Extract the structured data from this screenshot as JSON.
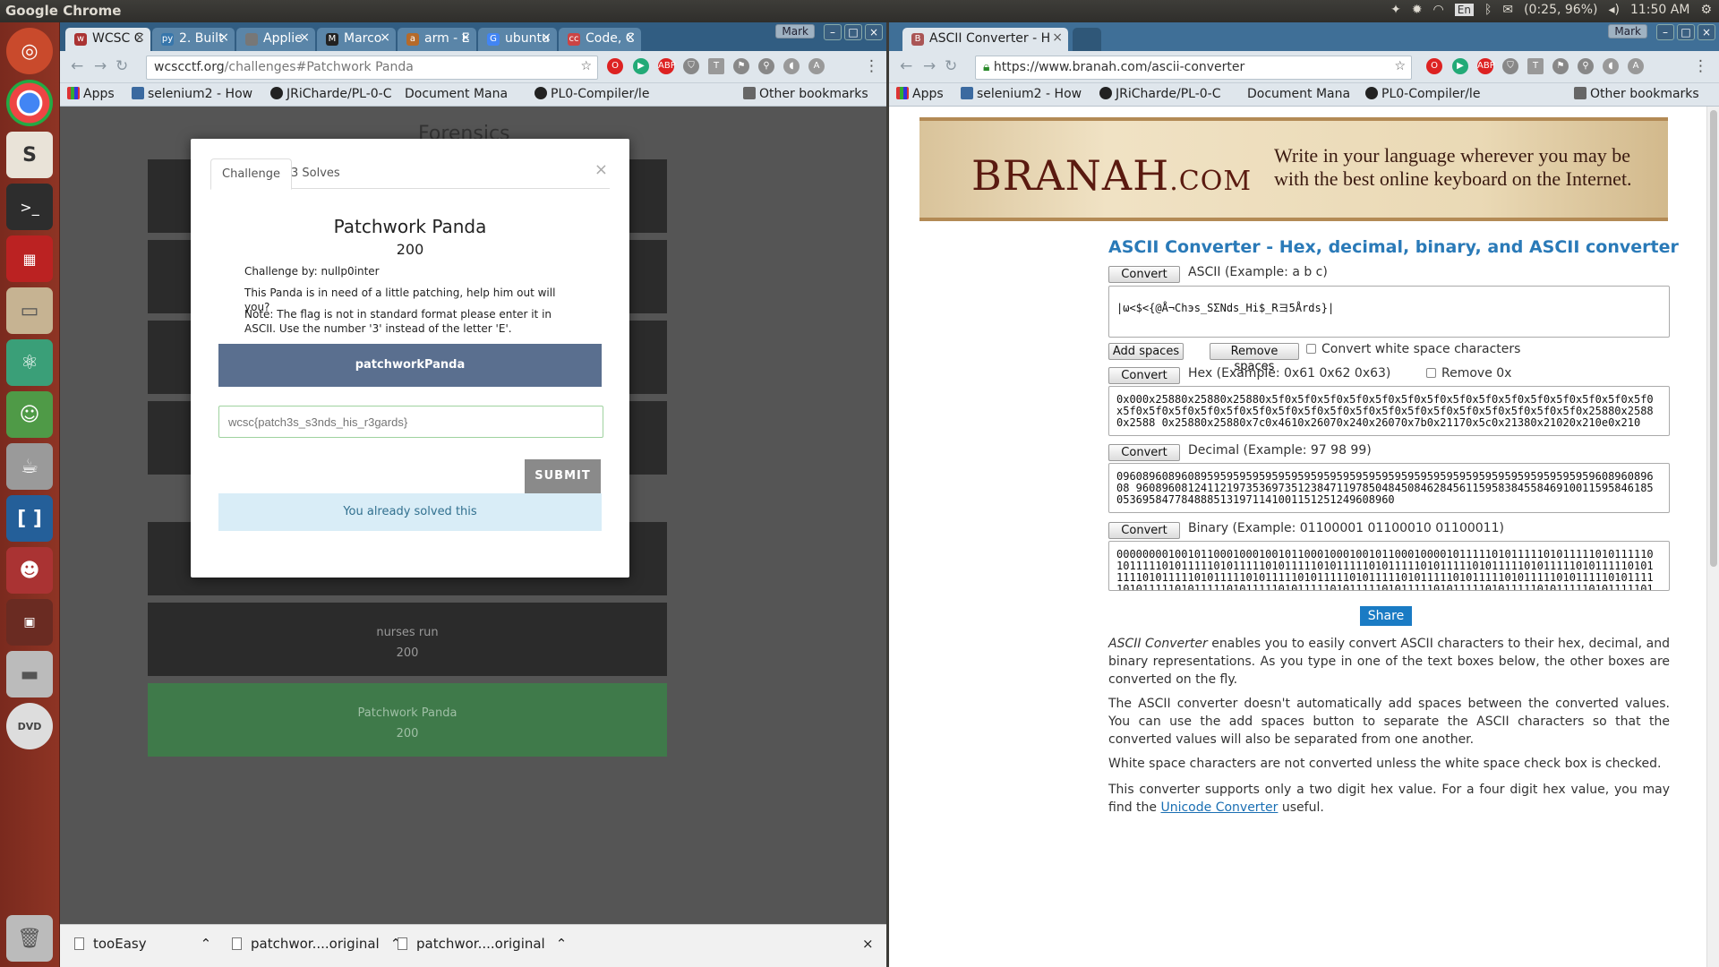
{
  "system": {
    "app_name": "Google Chrome",
    "time": "11:50 AM",
    "battery": "(0:25, 96%)",
    "keyboard": "En"
  },
  "left": {
    "user": "Mark",
    "tabs": [
      {
        "label": "WCSC C",
        "active": true
      },
      {
        "label": "2. Built",
        "active": false
      },
      {
        "label": "Applie",
        "active": false
      },
      {
        "label": "Marco",
        "active": false
      },
      {
        "label": "arm - E",
        "active": false
      },
      {
        "label": "ubuntu",
        "active": false
      },
      {
        "label": "Code, C",
        "active": false
      }
    ],
    "url_host": "wcscctf.org",
    "url_path": "/challenges#Patchwork Panda",
    "bookmarks": [
      "Apps",
      "selenium2 - How",
      "JRiCharde/PL-0-C",
      "Document Mana",
      "PL0-Compiler/le",
      "Other bookmarks"
    ],
    "page": {
      "heading": "Forensics",
      "cards": [
        {
          "name": "",
          "points": ""
        },
        {
          "name": "",
          "points": ""
        },
        {
          "name": "",
          "points": ""
        },
        {
          "name": "",
          "points": ""
        },
        {
          "name": "",
          "points": ""
        },
        {
          "name": "nurses run",
          "points": "200"
        },
        {
          "name": "Patchwork Panda",
          "points": "200"
        }
      ]
    },
    "modal": {
      "tab_challenge": "Challenge",
      "tab_solves": "3 Solves",
      "title": "Patchwork Panda",
      "points": "200",
      "author": "Challenge by: nullp0inter",
      "description": "This Panda is in need of a little patching, help him out will you?",
      "note": "Note: The flag is not in standard format please enter it in ASCII. Use the number '3' instead of the letter 'E'.",
      "file_button": "patchworkPanda",
      "flag_placeholder": "wcsc{patch3s_s3nds_his_r3gards}",
      "submit": "SUBMIT",
      "solved_msg": "You already solved this"
    },
    "downloads": [
      "tooEasy",
      "patchwor....original",
      "patchwor....original"
    ]
  },
  "right": {
    "user": "Mark",
    "tab_label": "ASCII Converter - H",
    "url": "https://www.branah.com/ascii-converter",
    "bookmarks": [
      "Apps",
      "selenium2 - How",
      "JRiCharde/PL-0-C",
      "Document Mana",
      "PL0-Compiler/le",
      "Other bookmarks"
    ],
    "banner": {
      "logo": "BRANAH",
      "logo_suffix": ".COM",
      "slogan": "Write in your language wherever you may be with the best online keyboard on the Internet."
    },
    "title": "ASCII Converter - Hex, decimal, binary, and ASCII converter",
    "convert": "Convert",
    "ascii_label": "ASCII (Example: a b c)",
    "ascii_value": "|ω<$<{@Å¬Chэs_SΣNds_Hi$_Rヨ5Årds}|",
    "add_spaces": "Add spaces",
    "remove_spaces": "Remove spaces",
    "convert_ws": "Convert white space characters",
    "hex_label": "Hex (Example: 0x61 0x62 0x63)",
    "remove_0x": "Remove 0x",
    "hex_value": "0x000x25880x25880x25880x5f0x5f0x5f0x5f0x5f0x5f0x5f0x5f0x5f0x5f0x5f0x5f0x5f0x5f0x5f0x5f0x5f0x5f0x5f0x5f0x5f0x5f0x5f0x5f0x5f0x5f0x5f0x5f0x5f0x5f0x5f0x5f0x5f0x25880x25880x2588 0x25880x25880x7c0x4610x26070x240x26070x7b0x21170x5c0x21380x21020x210e0x210",
    "decimal_label": "Decimal (Example: 97 98 99)",
    "decimal_value": "0960896089608959595959595959595959595959595959595959595959595959595959595960896089608 960896081241121973536973512384711978504845084628456115958384558469100115958461850536958477848885131971141001151251249608960",
    "binary_label": "Binary (Example: 01100001 01100010 01100011)",
    "binary_value": "0000000010010110001000100101100010001001011000100001011111010111110101111101011111010111110101111101011111010111110101111101011111010111110101111101011111010111110101111101011111010111110101111101011111010111110101111101011111010111110101111101011111010111110101111101011111010111110101111101011111010111110101111101011111010111110101111101011111010111110101111101",
    "share": "Share",
    "p1_em": "ASCII Converter",
    "p1_rest": " enables you to easily convert ASCII characters to their hex, decimal, and binary representations. As you type in one of the text boxes below, the other boxes are converted on the fly.",
    "p2": "The ASCII converter doesn't automatically add spaces between the converted values. You can use the add spaces button to separate the ASCII characters so that the converted values will also be separated from one another.",
    "p3": "White space characters are not converted unless the white space check box is checked.",
    "p4_start": "This converter supports only a two digit hex value. For a four digit hex value, you may find the ",
    "p4_link": "Unicode Converter",
    "p4_end": " useful."
  }
}
